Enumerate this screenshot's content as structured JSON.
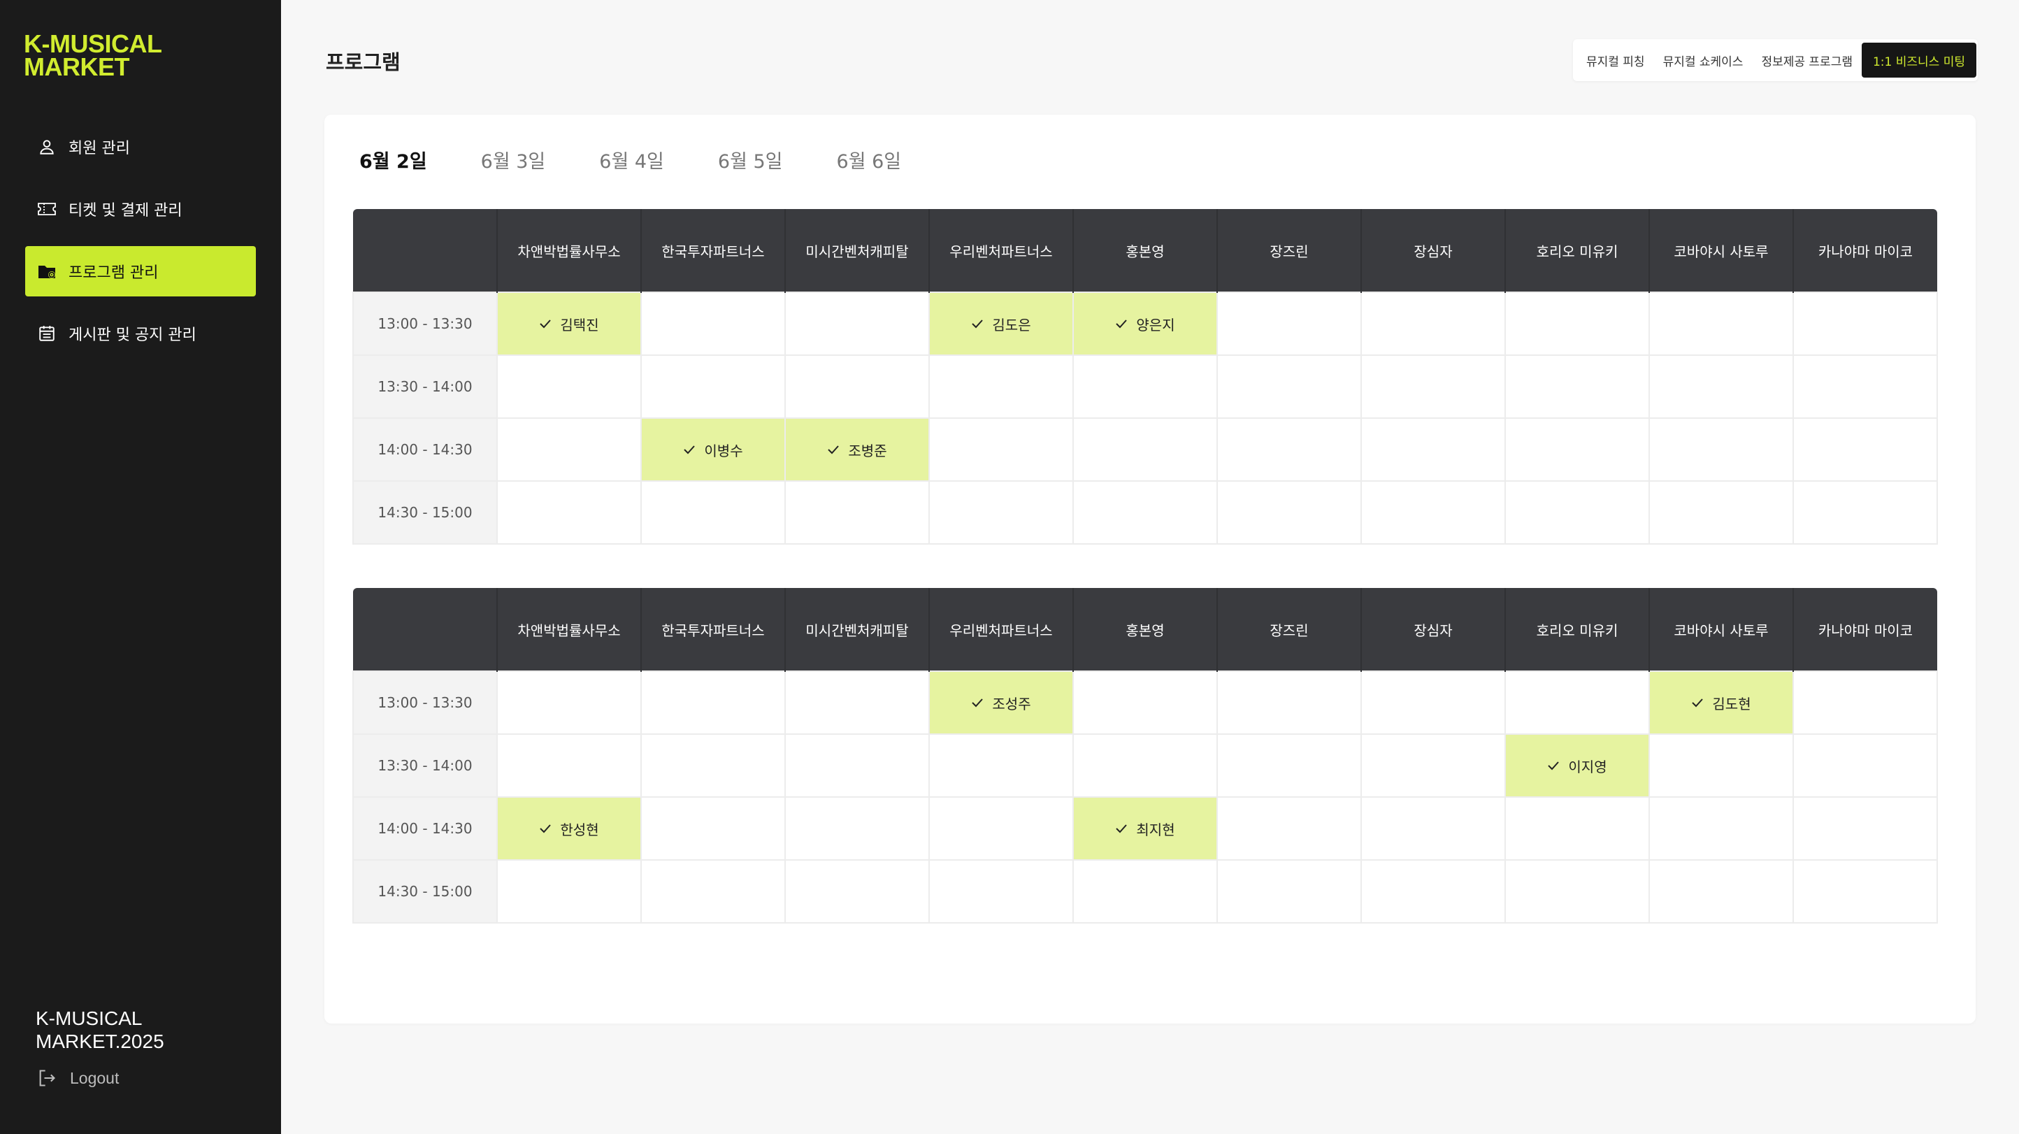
{
  "brand": {
    "logo_line1": "K-MUSICAL",
    "logo_line2": "MARKET",
    "accent": "#c9ea2e",
    "sidebar_bg": "#1b1b1b"
  },
  "sidebar": {
    "items": [
      {
        "label": "회원 관리",
        "icon": "user-icon"
      },
      {
        "label": "티켓 및 결제 관리",
        "icon": "ticket-icon"
      },
      {
        "label": "프로그램 관리",
        "icon": "folder-settings-icon",
        "active": true
      },
      {
        "label": "게시판 및 공지 관리",
        "icon": "calendar-icon"
      }
    ],
    "footer_line1": "K-MUSICAL",
    "footer_line2": "MARKET.2025",
    "logout_label": "Logout"
  },
  "header": {
    "title": "프로그램"
  },
  "top_tabs": [
    {
      "label": "뮤지컬 피칭"
    },
    {
      "label": "뮤지컬 쇼케이스"
    },
    {
      "label": "정보제공 프로그램"
    },
    {
      "label": "1:1 비즈니스 미팅",
      "active": true
    }
  ],
  "date_tabs": [
    {
      "label": "6월 2일",
      "active": true
    },
    {
      "label": "6월 3일"
    },
    {
      "label": "6월 4일"
    },
    {
      "label": "6월 5일"
    },
    {
      "label": "6월 6일"
    }
  ],
  "tables": [
    {
      "columns": [
        "",
        "차앤박법률사무소",
        "한국투자파트너스",
        "미시간벤처캐피탈",
        "우리벤처파트너스",
        "홍본영",
        "장즈린",
        "장심자",
        "호리오 미유키",
        "코바야시 사토루",
        "카나야마 마이코"
      ],
      "rows": [
        {
          "time": "13:00 - 13:30",
          "cells": [
            "김택진",
            "",
            "",
            "김도은",
            "양은지",
            "",
            "",
            "",
            "",
            ""
          ]
        },
        {
          "time": "13:30 - 14:00",
          "cells": [
            "",
            "",
            "",
            "",
            "",
            "",
            "",
            "",
            "",
            ""
          ]
        },
        {
          "time": "14:00 - 14:30",
          "cells": [
            "",
            "이병수",
            "조병준",
            "",
            "",
            "",
            "",
            "",
            "",
            ""
          ]
        },
        {
          "time": "14:30 - 15:00",
          "cells": [
            "",
            "",
            "",
            "",
            "",
            "",
            "",
            "",
            "",
            ""
          ]
        }
      ]
    },
    {
      "columns": [
        "",
        "차앤박법률사무소",
        "한국투자파트너스",
        "미시간벤처캐피탈",
        "우리벤처파트너스",
        "홍본영",
        "장즈린",
        "장심자",
        "호리오 미유키",
        "코바야시 사토루",
        "카나야마 마이코"
      ],
      "rows": [
        {
          "time": "13:00 - 13:30",
          "cells": [
            "",
            "",
            "",
            "조성주",
            "",
            "",
            "",
            "",
            "김도현",
            ""
          ]
        },
        {
          "time": "13:30 - 14:00",
          "cells": [
            "",
            "",
            "",
            "",
            "",
            "",
            "",
            "이지영",
            "",
            ""
          ]
        },
        {
          "time": "14:00 - 14:30",
          "cells": [
            "한성현",
            "",
            "",
            "",
            "최지현",
            "",
            "",
            "",
            "",
            ""
          ]
        },
        {
          "time": "14:30 - 15:00",
          "cells": [
            "",
            "",
            "",
            "",
            "",
            "",
            "",
            "",
            "",
            ""
          ]
        }
      ]
    }
  ]
}
